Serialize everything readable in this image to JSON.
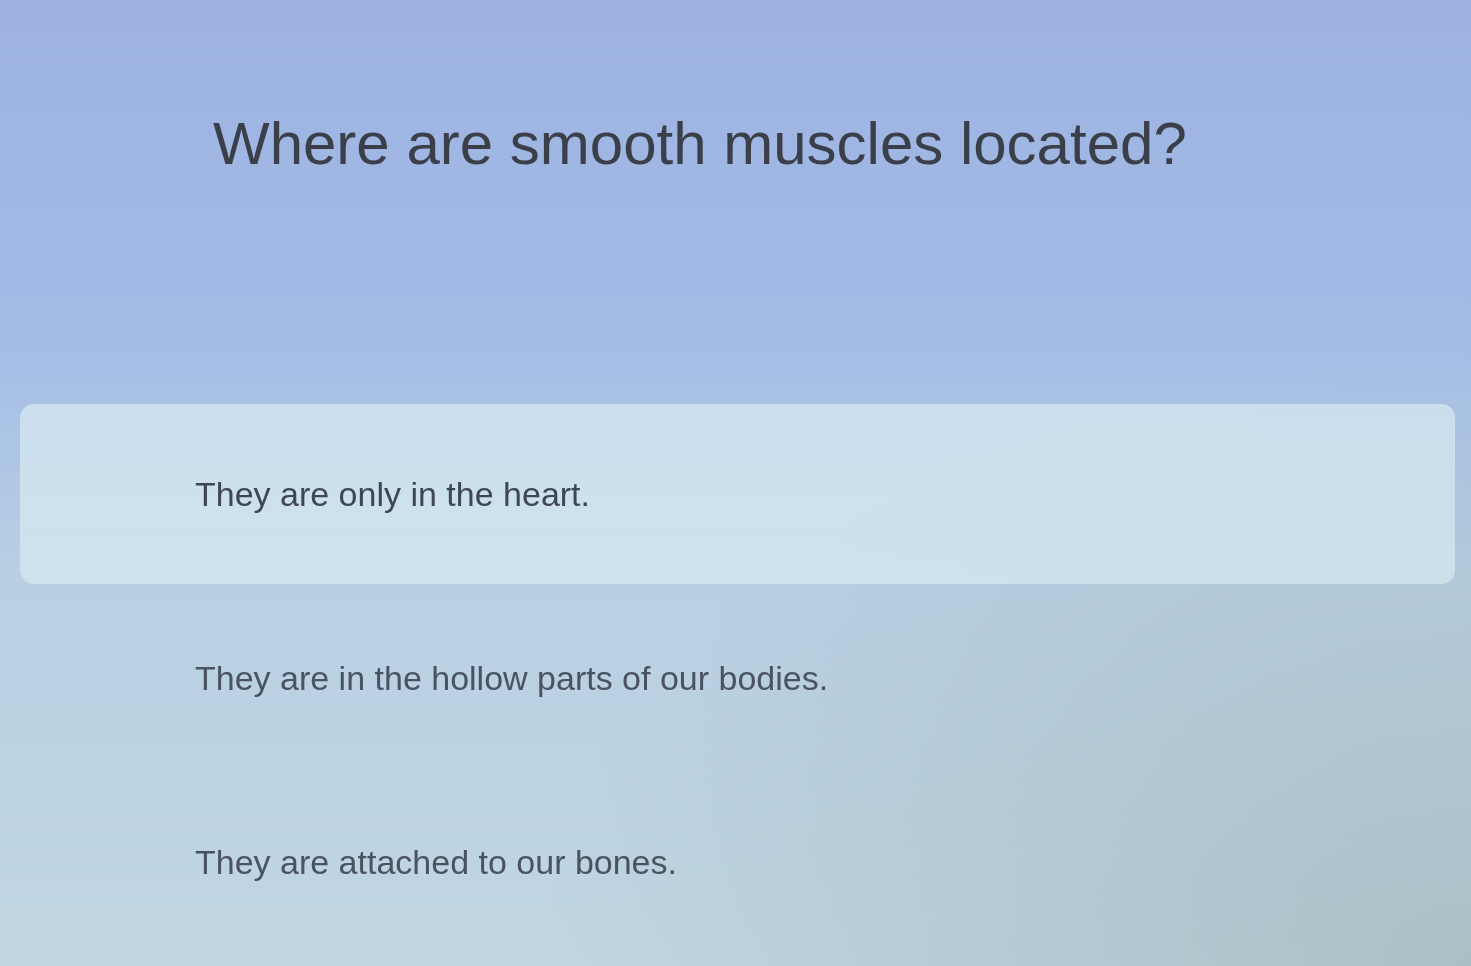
{
  "question": "Where are smooth muscles located?",
  "options": [
    {
      "label": "They are only in the heart.",
      "selected": true
    },
    {
      "label": "They are in the hollow parts of our bodies.",
      "selected": false
    },
    {
      "label": "They are attached to our bones.",
      "selected": false
    }
  ]
}
